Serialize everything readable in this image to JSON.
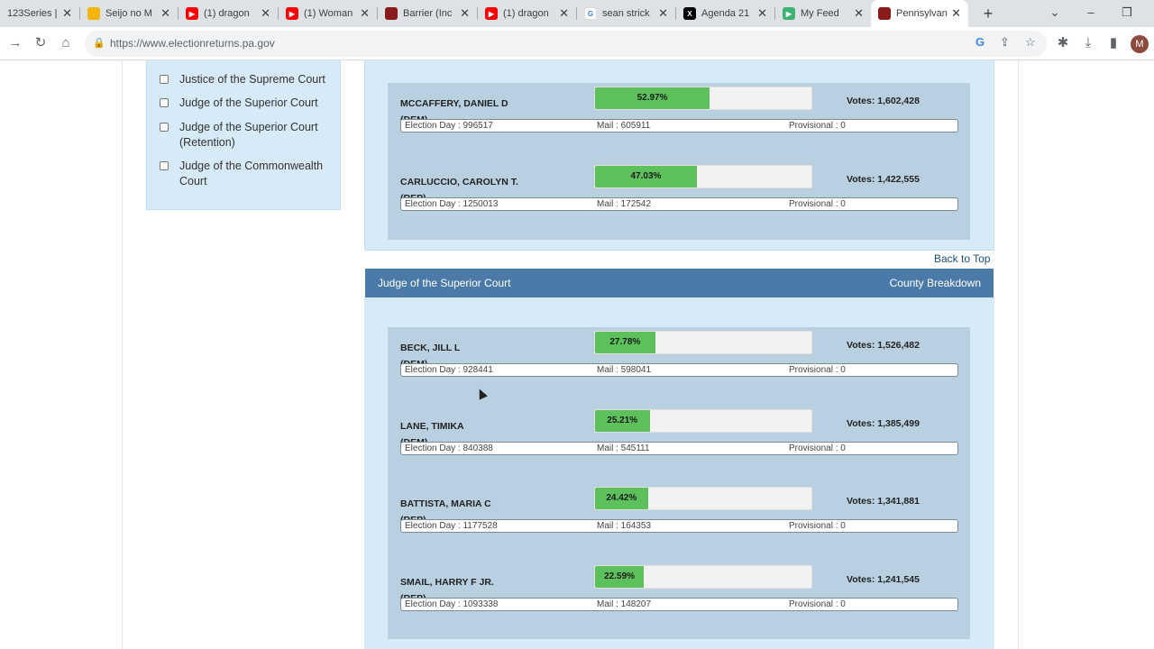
{
  "browser": {
    "tabs": [
      {
        "title": "123Series |",
        "color": "#e0e0e0",
        "glyph": ""
      },
      {
        "title": "Seijo no M",
        "color": "#f4b400",
        "glyph": "■"
      },
      {
        "title": "(1) dragon",
        "color": "#ff0000",
        "glyph": "▶"
      },
      {
        "title": "(1) Woman",
        "color": "#ff0000",
        "glyph": "▶"
      },
      {
        "title": "Barrier (Inc",
        "color": "#8b1a1a",
        "glyph": "⬢"
      },
      {
        "title": "(1) dragon",
        "color": "#ff0000",
        "glyph": "▶"
      },
      {
        "title": "sean strick",
        "color": "#4285f4",
        "glyph": "G"
      },
      {
        "title": "Agenda 21",
        "color": "#000000",
        "glyph": "X"
      },
      {
        "title": "My Feed",
        "color": "#3cb371",
        "glyph": "▶"
      },
      {
        "title": "Pennsylvan",
        "color": "#8b1a1a",
        "glyph": "▣"
      }
    ],
    "url": "https://www.electionreturns.pa.gov",
    "avatar_letter": "M"
  },
  "sidebar": {
    "items": [
      {
        "label": "Justice of the Supreme Court"
      },
      {
        "label": "Judge of the Superior Court"
      },
      {
        "label": "Judge of the Superior Court (Retention)"
      },
      {
        "label": "Judge of the Commonwealth Court"
      }
    ]
  },
  "supreme": {
    "candidates": [
      {
        "name": "MCCAFFERY, DANIEL D",
        "party": "(DEM)",
        "pct_label": "52.97%",
        "pct": 52.97,
        "votes": "Votes: 1,602,428",
        "election_day": "Election Day : 996517",
        "mail": "Mail : 605911",
        "provisional": "Provisional : 0"
      },
      {
        "name": "CARLUCCIO, CAROLYN T.",
        "party": "(REP)",
        "pct_label": "47.03%",
        "pct": 47.03,
        "votes": "Votes: 1,422,555",
        "election_day": "Election Day : 1250013",
        "mail": "Mail : 172542",
        "provisional": "Provisional : 0"
      }
    ]
  },
  "back_to_top": "Back to Top",
  "superior": {
    "title": "Judge of the Superior Court",
    "breakdown_link": "County Breakdown",
    "candidates": [
      {
        "name": "BECK, JILL L",
        "party": "(DEM)",
        "pct_label": "27.78%",
        "pct": 27.78,
        "votes": "Votes: 1,526,482",
        "election_day": "Election Day : 928441",
        "mail": "Mail : 598041",
        "provisional": "Provisional : 0"
      },
      {
        "name": "LANE, TIMIKA",
        "party": "(DEM)",
        "pct_label": "25.21%",
        "pct": 25.21,
        "votes": "Votes: 1,385,499",
        "election_day": "Election Day : 840388",
        "mail": "Mail : 545111",
        "provisional": "Provisional : 0"
      },
      {
        "name": "BATTISTA, MARIA C",
        "party": "(REP)",
        "pct_label": "24.42%",
        "pct": 24.42,
        "votes": "Votes: 1,341,881",
        "election_day": "Election Day : 1177528",
        "mail": "Mail : 164353",
        "provisional": "Provisional : 0"
      },
      {
        "name": "SMAIL, HARRY F JR.",
        "party": "(REP)",
        "pct_label": "22.59%",
        "pct": 22.59,
        "votes": "Votes: 1,241,545",
        "election_day": "Election Day : 1093338",
        "mail": "Mail : 148207",
        "provisional": "Provisional : 0"
      }
    ]
  }
}
